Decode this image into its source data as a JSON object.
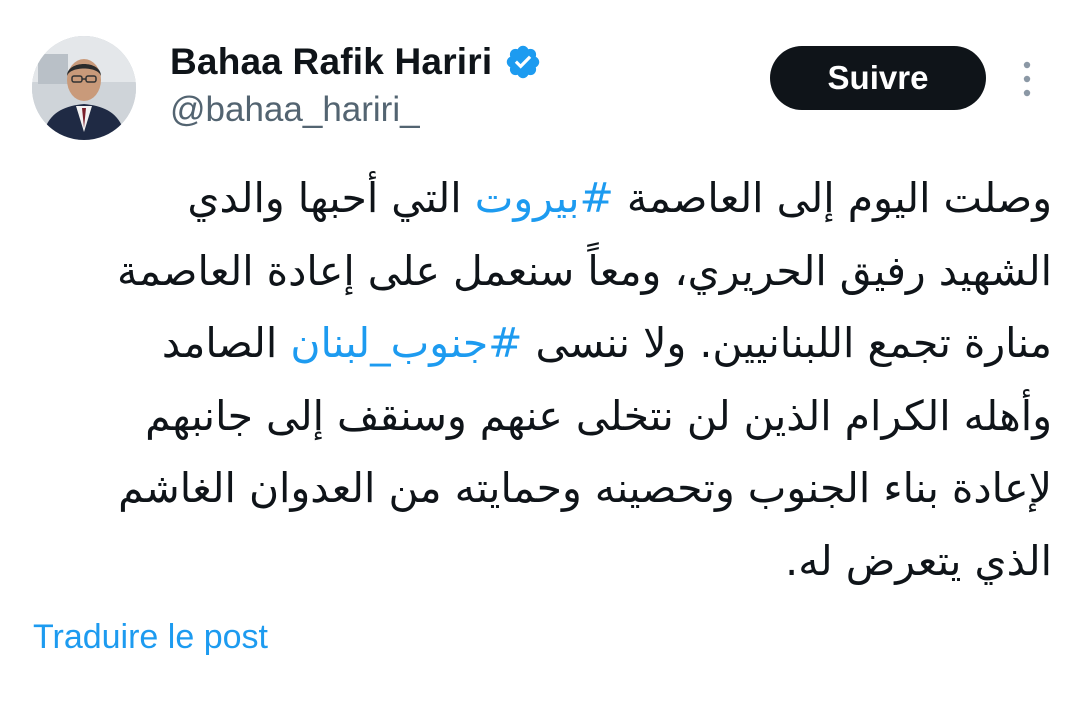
{
  "author": {
    "display_name": "Bahaa Rafik Hariri",
    "handle": "@bahaa_hariri_",
    "verified_icon": "verified-badge-icon",
    "avatar_icon": "profile-photo"
  },
  "actions": {
    "follow_label": "Suivre",
    "more_icon": "more-vertical-icon"
  },
  "post": {
    "lines": [
      {
        "before": "وصلت اليوم إلى العاصمة ",
        "hashtag": "#بيروت",
        "after": " التي أحبها والدي"
      },
      {
        "text": "الشهيد رفيق الحريري، ومعاً سنعمل على إعادة العاصمة"
      },
      {
        "before": "منارة تجمع اللبنانيين. ولا ننسى ",
        "hashtag": "#جنوب_لبنان",
        "after": " الصامد"
      },
      {
        "text": "وأهله الكرام الذين لن نتخلى عنهم وسنقف إلى جانبهم"
      },
      {
        "text": "لإعادة بناء الجنوب وتحصينه وحمايته من العدوان الغاشم"
      },
      {
        "text": "الذي يتعرض له."
      }
    ]
  },
  "footer": {
    "translate_label": "Traduire le post"
  },
  "colors": {
    "link": "#1d9bf0",
    "text": "#0f1419",
    "secondary": "#536471",
    "button_bg": "#0f1419"
  }
}
